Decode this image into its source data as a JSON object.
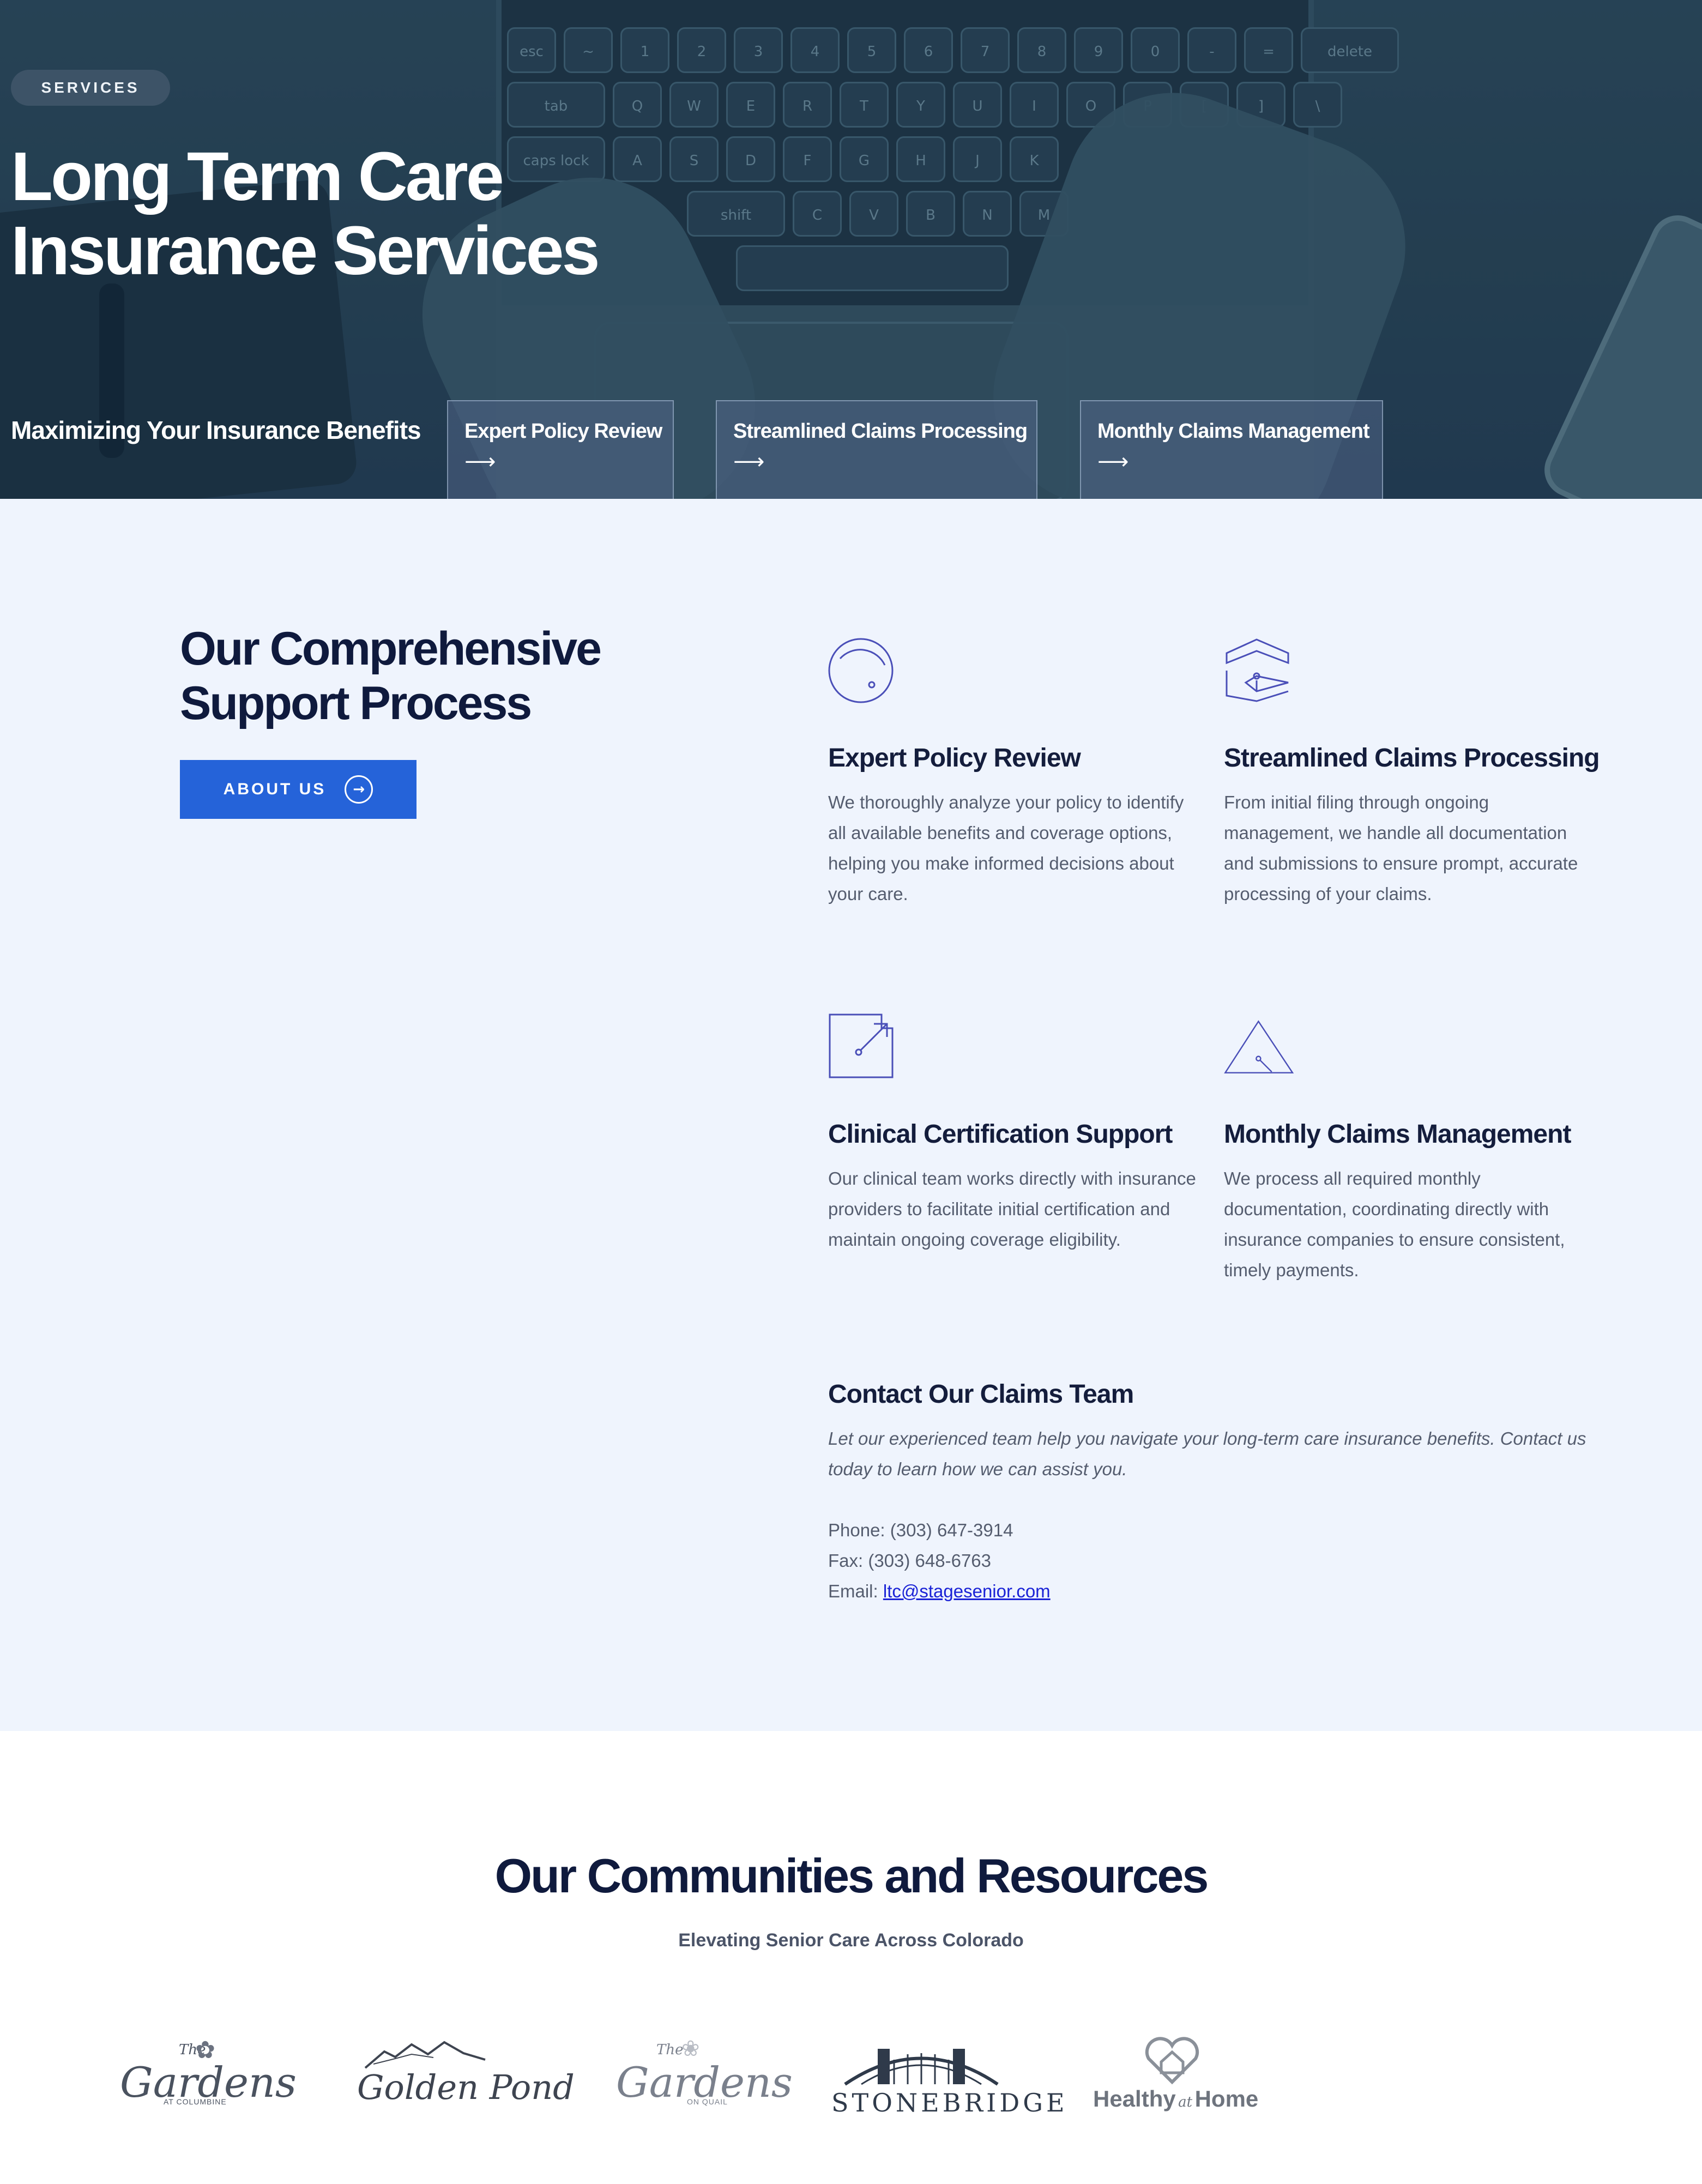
{
  "hero": {
    "badge": "SERVICES",
    "title_line1": "Long Term Care",
    "title_line2": "Insurance Services",
    "subtitle": "Maximizing Your Insurance Benefits",
    "cards": [
      {
        "label": "Expert Policy Review",
        "arrow": "⟶"
      },
      {
        "label": "Streamlined Claims Processing",
        "arrow": "⟶"
      },
      {
        "label": "Monthly Claims Management",
        "arrow": "⟶"
      }
    ],
    "keyboard_keys": [
      "esc",
      "~",
      "1",
      "2",
      "3",
      "4",
      "5",
      "6",
      "7",
      "8",
      "9",
      "0",
      "-",
      "=",
      "delete",
      "tab",
      "Q",
      "W",
      "E",
      "R",
      "T",
      "Y",
      "U",
      "I",
      "O",
      "P",
      "[",
      "]",
      "\\",
      "caps lock",
      "A",
      "S",
      "D",
      "F",
      "G",
      "H",
      "J",
      "K",
      "shift",
      "C",
      "V",
      "B",
      "N",
      "M"
    ]
  },
  "process": {
    "title_line1": "Our Comprehensive",
    "title_line2": "Support Process",
    "about_button": "ABOUT US",
    "about_icon": "→",
    "services": [
      {
        "icon": "circle-outline-icon",
        "title": "Expert Policy Review",
        "text": "We thoroughly analyze your policy to identify all available benefits and coverage options, helping you make informed decisions about your care."
      },
      {
        "icon": "cube-outline-icon",
        "title": "Streamlined Claims Processing",
        "text": "From initial filing through ongoing management, we handle all documentation and submissions to ensure prompt, accurate processing of your claims."
      },
      {
        "icon": "square-arrow-icon",
        "title": "Clinical Certification Support",
        "text": "Our clinical team works directly with insurance providers to facilitate initial certification and maintain ongoing coverage eligibility."
      },
      {
        "icon": "triangle-outline-icon",
        "title": "Monthly Claims Management",
        "text": "We process all required monthly documentation, coordinating directly with insurance companies to ensure consistent, timely payments."
      }
    ],
    "contact": {
      "title": "Contact Our Claims Team",
      "intro": "Let our experienced team help you navigate your long-term care insurance benefits. Contact us today to learn how we can assist you.",
      "phone": "Phone: (303) 647-3914",
      "fax": "Fax: (303) 648-6763",
      "email_label": "Email: ",
      "email": "ltc@stagesenior.com"
    }
  },
  "communities": {
    "title": "Our Communities and Resources",
    "subtitle": "Elevating Senior Care Across Colorado",
    "logos": [
      {
        "main": "Gardens",
        "small_top": "The",
        "small_bottom": "AT COLUMBINE"
      },
      {
        "main": "Golden Pond"
      },
      {
        "main": "Gardens",
        "small_top": "The",
        "small_bottom": "ON QUAIL"
      },
      {
        "main": "STONEBRIDGE"
      },
      {
        "main_a": "Healthy",
        "main_b": "at",
        "main_c": "Home"
      }
    ]
  },
  "colors": {
    "accent": "#2563d9",
    "dark_navy": "#0f1a3d",
    "section_bg": "#eff4fd",
    "icon_stroke": "#4a4fb8",
    "link": "#1a22d6"
  }
}
